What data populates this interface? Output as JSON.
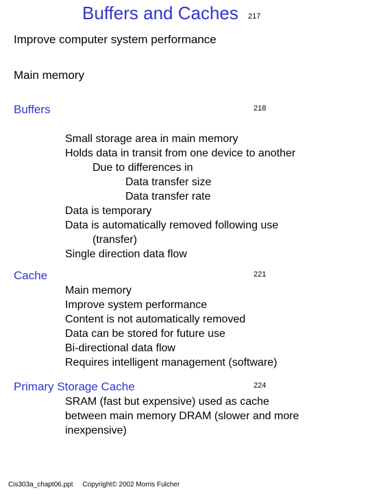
{
  "title": "Buffers and Caches",
  "page_refs": {
    "p1": "217",
    "p2": "218",
    "p3": "221",
    "p4": "224"
  },
  "subtitle": "Improve computer system performance",
  "main_memory": "Main memory",
  "buffers_hdr": "Buffers",
  "buffers_body": {
    "l1": "Small storage area in main memory",
    "l2": "Holds data in transit from one device to another",
    "l3": "Due to differences in",
    "l4": "Data transfer size",
    "l5": "Data transfer rate",
    "l6": "Data is temporary",
    "l7": "Data is automatically removed following use",
    "l8": "(transfer)",
    "l9": "Single direction data flow"
  },
  "cache_hdr": "Cache",
  "cache_body": {
    "l1": "Main memory",
    "l2": "Improve system performance",
    "l3": "Content is not automatically removed",
    "l4": "Data can be stored for future use",
    "l5": "Bi-directional data flow",
    "l6": "Requires intelligent management (software)"
  },
  "psc_hdr": "Primary Storage Cache",
  "psc_body": {
    "l1": "SRAM (fast but expensive) used as cache",
    "l2": "between main memory DRAM (slower and more",
    "l3": "inexpensive)"
  },
  "footer": {
    "file": "Cis303a_chapt06.ppt",
    "copy": "Copyright© 2002 Morris Fulcher"
  }
}
